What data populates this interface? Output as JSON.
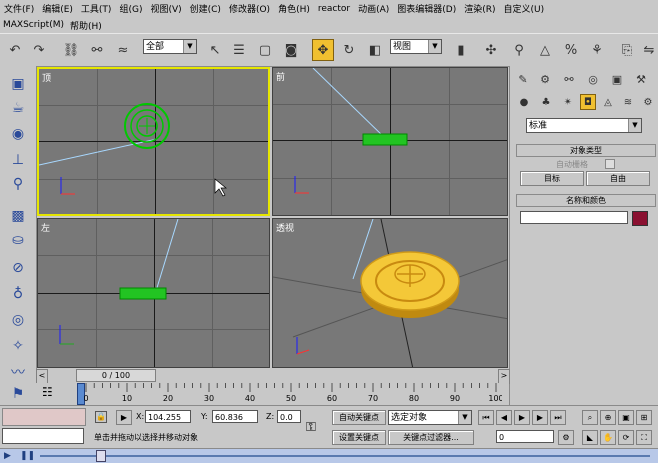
{
  "menu": {
    "items": [
      "文件(F)",
      "编辑(E)",
      "工具(T)",
      "组(G)",
      "视图(V)",
      "创建(C)",
      "修改器(O)",
      "角色(H)",
      "reactor",
      "动画(A)",
      "图表编辑器(D)",
      "渲染(R)",
      "自定义(U)"
    ],
    "row2": [
      "MAXScript(M)",
      "帮助(H)"
    ]
  },
  "toolbar": {
    "selection_filter": "全部",
    "coord_system": "视图",
    "active_tool": "move-icon"
  },
  "viewports": {
    "top": "顶",
    "front": "前",
    "left": "左",
    "perspective": "透视"
  },
  "command_panel": {
    "category_dropdown": "标准",
    "object_type_header": "对象类型",
    "autogrid_label": "自动栅格",
    "target_button": "目标",
    "free_button": "自由",
    "name_color_header": "名称和颜色",
    "object_color": "#8a1030"
  },
  "timeline": {
    "frame_display": "0 / 100",
    "ticks": [
      "0",
      "10",
      "20",
      "30",
      "40",
      "50",
      "60",
      "70",
      "80",
      "90",
      "100"
    ]
  },
  "status": {
    "x_value": "104.255",
    "y_value": "60.836",
    "z_value": "0.0",
    "auto_key": "自动关键点",
    "set_key": "设置关键点",
    "key_mode": "选定对象",
    "key_filters": "关键点过滤器...",
    "frame": "0",
    "prompt": "单击并拖动以选择并移动对象",
    "x_label": "X:",
    "y_label": "Y:",
    "z_label": "Z:"
  },
  "colors": {
    "accent_active": "#e6e600",
    "object_green": "#00c800",
    "coin_gold": "#f0c030"
  }
}
